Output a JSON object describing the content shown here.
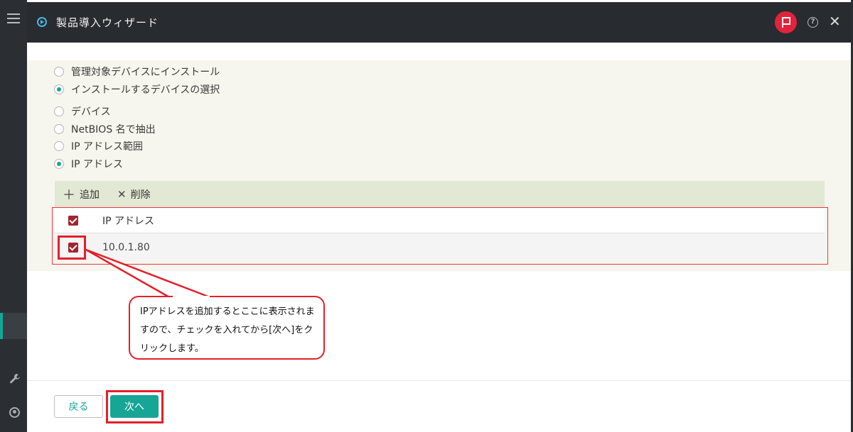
{
  "header": {
    "title": "製品導入ウィザード",
    "logo_icon": "play-circle-icon",
    "flag_icon": "flag-icon",
    "help_icon": "help-icon",
    "help_glyph": "?",
    "close_icon": "close-icon",
    "close_glyph": "✕"
  },
  "install_target": {
    "options": [
      {
        "label": "管理対象デバイスにインストール",
        "selected": false
      },
      {
        "label": "インストールするデバイスの選択",
        "selected": true
      }
    ]
  },
  "device_method": {
    "options": [
      {
        "label": "デバイス",
        "selected": false
      },
      {
        "label": "NetBIOS 名で抽出",
        "selected": false
      },
      {
        "label": "IP アドレス範囲",
        "selected": false
      },
      {
        "label": "IP アドレス",
        "selected": true
      }
    ]
  },
  "toolbar": {
    "add_glyph": "＋",
    "add_label": "追加",
    "delete_glyph": "✕",
    "delete_label": "削除"
  },
  "grid": {
    "header": "IP アドレス",
    "rows": [
      {
        "value": "10.0.1.80",
        "checked": true
      }
    ]
  },
  "callout": {
    "text": "IPアドレスを追加するとここに表示されますので、チェックを入れてから[次へ]をクリックします。"
  },
  "footer": {
    "back_label": "戻る",
    "next_label": "次へ"
  },
  "colors": {
    "accent": "#17a596",
    "highlight": "#e3202b",
    "checkbox": "#a3232e",
    "header_bg": "#282c30"
  }
}
